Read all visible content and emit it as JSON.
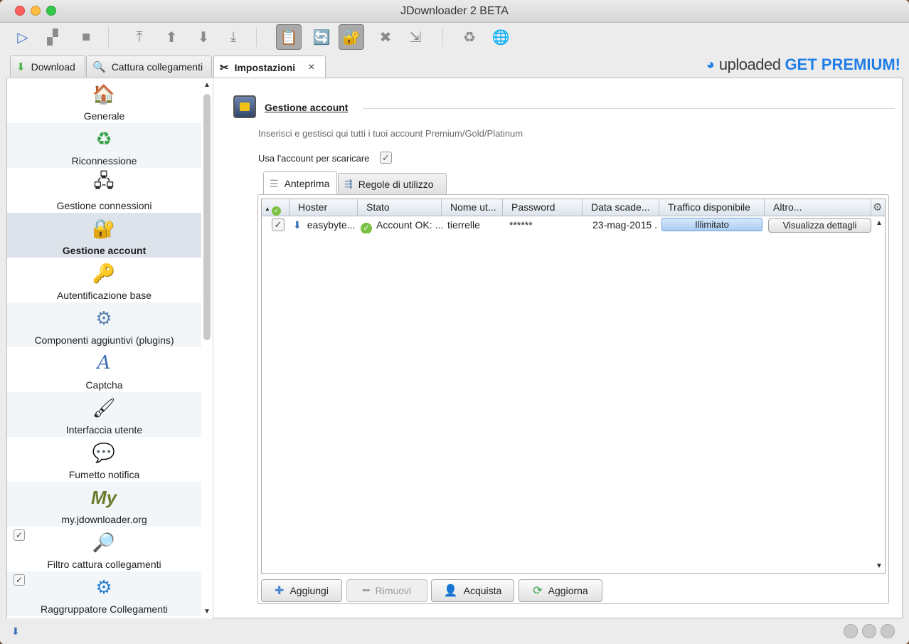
{
  "window": {
    "title": "JDownloader 2 BETA"
  },
  "toolbar": {
    "buttons": [
      "play-icon",
      "pause-icon",
      "stop-icon",
      "move-top-icon",
      "move-up-icon",
      "move-down-icon",
      "move-bottom-icon",
      "clipboard-icon",
      "reconnect-icon",
      "premium-icon",
      "remove-icon",
      "stop-after-icon",
      "reconnect-now-icon",
      "update-icon"
    ]
  },
  "tabs": [
    {
      "label": "Download",
      "icon": "download-icon"
    },
    {
      "label": "Cattura collegamenti",
      "icon": "link-grabber-icon"
    },
    {
      "label": "Impostazioni",
      "icon": "settings-icon",
      "close": "×"
    }
  ],
  "brand": {
    "name": "uploaded",
    "cta": "GET PREMIUM!"
  },
  "sidebar": {
    "items": [
      {
        "label": "Generale",
        "icon": "home-icon"
      },
      {
        "label": "Riconnessione",
        "icon": "reconnect-icon"
      },
      {
        "label": "Gestione connessioni",
        "icon": "network-icon"
      },
      {
        "label": "Gestione account",
        "icon": "account-icon"
      },
      {
        "label": "Autentificazione base",
        "icon": "key-user-icon"
      },
      {
        "label": "Componenti aggiuntivi (plugins)",
        "icon": "plugin-icon"
      },
      {
        "label": "Captcha",
        "icon": "captcha-icon"
      },
      {
        "label": "Interfaccia utente",
        "icon": "paint-icon"
      },
      {
        "label": "Fumetto notifica",
        "icon": "bubble-icon"
      },
      {
        "label": "my.jdownloader.org",
        "icon": "my-jd-icon"
      },
      {
        "label": "Filtro cattura collegamenti",
        "icon": "filter-icon"
      },
      {
        "label": "Raggruppatore Collegamenti",
        "icon": "packagizer-icon"
      }
    ]
  },
  "main": {
    "section_title": "Gestione account",
    "description": "Inserisci e gestisci qui tutti i tuoi account Premium/Gold/Platinum",
    "use_account_label": "Usa l'account per scaricare",
    "subtabs": [
      "Anteprima",
      "Regole di utilizzo"
    ],
    "table": {
      "columns": [
        "Hoster",
        "Stato",
        "Nome ut...",
        "Password",
        "Data scade...",
        "Traffico disponibile",
        "Altro..."
      ],
      "sort_indicator": "▲",
      "rows": [
        {
          "hoster": "easybyte...",
          "status": "Account OK: ...",
          "username": "tierrelle",
          "password": "******",
          "expiry": "23-mag-2015 ...",
          "traffic": "Illimitato",
          "other": "Visualizza dettagli"
        }
      ]
    },
    "buttons": {
      "add": "Aggiungi",
      "remove": "Rimuovi",
      "buy": "Acquista",
      "refresh": "Aggiorna"
    }
  },
  "colors": {
    "accent_blue": "#1f7de6",
    "ok_green": "#7cc242",
    "traffic_bar": "#a9cdf3",
    "selected_item": "#dde3ea"
  }
}
